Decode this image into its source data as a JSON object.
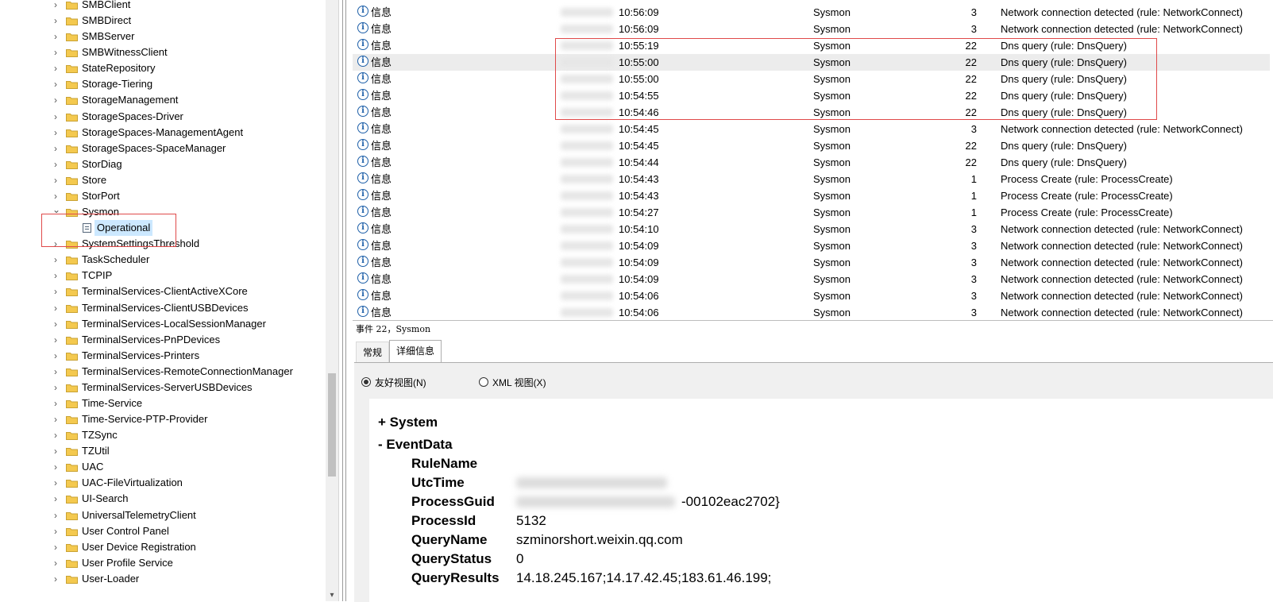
{
  "tree": {
    "items": [
      {
        "label": "SMBClient",
        "expanded": false
      },
      {
        "label": "SMBDirect",
        "expanded": false
      },
      {
        "label": "SMBServer",
        "expanded": false
      },
      {
        "label": "SMBWitnessClient",
        "expanded": false
      },
      {
        "label": "StateRepository",
        "expanded": false
      },
      {
        "label": "Storage-Tiering",
        "expanded": false
      },
      {
        "label": "StorageManagement",
        "expanded": false
      },
      {
        "label": "StorageSpaces-Driver",
        "expanded": false
      },
      {
        "label": "StorageSpaces-ManagementAgent",
        "expanded": false
      },
      {
        "label": "StorageSpaces-SpaceManager",
        "expanded": false
      },
      {
        "label": "StorDiag",
        "expanded": false
      },
      {
        "label": "Store",
        "expanded": false
      },
      {
        "label": "StorPort",
        "expanded": false
      },
      {
        "label": "Sysmon",
        "expanded": true
      },
      {
        "label": "Operational",
        "child": true
      },
      {
        "label": "SystemSettingsThreshold",
        "expanded": false
      },
      {
        "label": "TaskScheduler",
        "expanded": false
      },
      {
        "label": "TCPIP",
        "expanded": false
      },
      {
        "label": "TerminalServices-ClientActiveXCore",
        "expanded": false
      },
      {
        "label": "TerminalServices-ClientUSBDevices",
        "expanded": false
      },
      {
        "label": "TerminalServices-LocalSessionManager",
        "expanded": false
      },
      {
        "label": "TerminalServices-PnPDevices",
        "expanded": false
      },
      {
        "label": "TerminalServices-Printers",
        "expanded": false
      },
      {
        "label": "TerminalServices-RemoteConnectionManager",
        "expanded": false
      },
      {
        "label": "TerminalServices-ServerUSBDevices",
        "expanded": false
      },
      {
        "label": "Time-Service",
        "expanded": false
      },
      {
        "label": "Time-Service-PTP-Provider",
        "expanded": false
      },
      {
        "label": "TZSync",
        "expanded": false
      },
      {
        "label": "TZUtil",
        "expanded": false
      },
      {
        "label": "UAC",
        "expanded": false
      },
      {
        "label": "UAC-FileVirtualization",
        "expanded": false
      },
      {
        "label": "UI-Search",
        "expanded": false
      },
      {
        "label": "UniversalTelemetryClient",
        "expanded": false
      },
      {
        "label": "User Control Panel",
        "expanded": false
      },
      {
        "label": "User Device Registration",
        "expanded": false
      },
      {
        "label": "User Profile Service",
        "expanded": false
      },
      {
        "label": "User-Loader",
        "expanded": false
      }
    ]
  },
  "events": [
    {
      "level": "信息",
      "time": "10:56:09",
      "source": "Sysmon",
      "id": "3",
      "task": "Network connection detected (rule: NetworkConnect)"
    },
    {
      "level": "信息",
      "time": "10:56:09",
      "source": "Sysmon",
      "id": "3",
      "task": "Network connection detected (rule: NetworkConnect)"
    },
    {
      "level": "信息",
      "time": "10:55:19",
      "source": "Sysmon",
      "id": "22",
      "task": "Dns query (rule: DnsQuery)"
    },
    {
      "level": "信息",
      "time": "10:55:00",
      "source": "Sysmon",
      "id": "22",
      "task": "Dns query (rule: DnsQuery)",
      "selected": true
    },
    {
      "level": "信息",
      "time": "10:55:00",
      "source": "Sysmon",
      "id": "22",
      "task": "Dns query (rule: DnsQuery)"
    },
    {
      "level": "信息",
      "time": "10:54:55",
      "source": "Sysmon",
      "id": "22",
      "task": "Dns query (rule: DnsQuery)"
    },
    {
      "level": "信息",
      "time": "10:54:46",
      "source": "Sysmon",
      "id": "22",
      "task": "Dns query (rule: DnsQuery)"
    },
    {
      "level": "信息",
      "time": "10:54:45",
      "source": "Sysmon",
      "id": "3",
      "task": "Network connection detected (rule: NetworkConnect)"
    },
    {
      "level": "信息",
      "time": "10:54:45",
      "source": "Sysmon",
      "id": "22",
      "task": "Dns query (rule: DnsQuery)"
    },
    {
      "level": "信息",
      "time": "10:54:44",
      "source": "Sysmon",
      "id": "22",
      "task": "Dns query (rule: DnsQuery)"
    },
    {
      "level": "信息",
      "time": "10:54:43",
      "source": "Sysmon",
      "id": "1",
      "task": "Process Create (rule: ProcessCreate)"
    },
    {
      "level": "信息",
      "time": "10:54:43",
      "source": "Sysmon",
      "id": "1",
      "task": "Process Create (rule: ProcessCreate)"
    },
    {
      "level": "信息",
      "time": "10:54:27",
      "source": "Sysmon",
      "id": "1",
      "task": "Process Create (rule: ProcessCreate)"
    },
    {
      "level": "信息",
      "time": "10:54:10",
      "source": "Sysmon",
      "id": "3",
      "task": "Network connection detected (rule: NetworkConnect)"
    },
    {
      "level": "信息",
      "time": "10:54:09",
      "source": "Sysmon",
      "id": "3",
      "task": "Network connection detected (rule: NetworkConnect)"
    },
    {
      "level": "信息",
      "time": "10:54:09",
      "source": "Sysmon",
      "id": "3",
      "task": "Network connection detected (rule: NetworkConnect)"
    },
    {
      "level": "信息",
      "time": "10:54:09",
      "source": "Sysmon",
      "id": "3",
      "task": "Network connection detected (rule: NetworkConnect)"
    },
    {
      "level": "信息",
      "time": "10:54:06",
      "source": "Sysmon",
      "id": "3",
      "task": "Network connection detected (rule: NetworkConnect)"
    },
    {
      "level": "信息",
      "time": "10:54:06",
      "source": "Sysmon",
      "id": "3",
      "task": "Network connection detected (rule: NetworkConnect)"
    }
  ],
  "detail": {
    "title": "事件 22，Sysmon",
    "tabs": [
      "常规",
      "详细信息"
    ],
    "active_tab": "详细信息",
    "view_friendly": "友好视图(N)",
    "view_xml": "XML 视图(X)",
    "system_label": "+ System",
    "eventdata_label": "- EventData",
    "fields": [
      {
        "key": "RuleName",
        "value": ""
      },
      {
        "key": "UtcTime",
        "value": ""
      },
      {
        "key": "ProcessGuid",
        "value": "-00102eac2702}"
      },
      {
        "key": "ProcessId",
        "value": "5132"
      },
      {
        "key": "QueryName",
        "value": "szminorshort.weixin.qq.com"
      },
      {
        "key": "QueryStatus",
        "value": "0"
      },
      {
        "key": "QueryResults",
        "value": "14.18.245.167;14.17.42.45;183.61.46.199;"
      }
    ]
  },
  "colors": {
    "highlight_border": "#e04a4a",
    "info_icon": "#1d5fa8",
    "selection": "#cce8ff",
    "folder": "#f4c94f"
  }
}
